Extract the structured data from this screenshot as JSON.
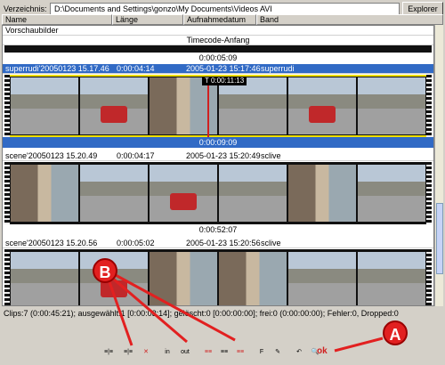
{
  "header": {
    "dir_label": "Verzeichnis:",
    "path": "D:\\Documents and Settings\\gonzo\\My Documents\\Videos AVI",
    "explorer_button": "Explorer"
  },
  "columns": [
    "Name",
    "Länge",
    "Aufnahmedatum",
    "Band"
  ],
  "list": {
    "preview_label": "Vorschaubilder",
    "timecode_label": "Timecode-Anfang",
    "first_duration": "0:00:05:09",
    "clips": [
      {
        "name": "superrudi'20050123 15.17.46",
        "length": "0:00:04:14",
        "date": "2005-01-23 15:17:46",
        "band": "superrudi",
        "duration": "0:00:09:09",
        "timecode": "T 0:00:11:13"
      },
      {
        "name": "scene'20050123 15.20.49",
        "length": "0:00:04:17",
        "date": "2005-01-23 15:20:49",
        "band": "sclive",
        "duration": "0:00:52:07"
      },
      {
        "name": "scene'20050123 15.20.56",
        "length": "0:00:05:02",
        "date": "2005-01-23 15:20:56",
        "band": "sclive",
        "duration": ""
      }
    ]
  },
  "status": "Clips:7 (0:00:45:21); ausgewählt:1 [0:00:03:14]; gelöscht:0 [0:00:00:00]; frei:0 (0:00:00:00); Fehler:0, Dropped:0",
  "toolbar": {
    "buttons": [
      "≡|≡",
      "≡|≡",
      "✕",
      "in",
      "out",
      "≡≡",
      "≡≡",
      "≡≡",
      "F",
      "✎",
      "↶",
      "🔍"
    ],
    "ok": "ok"
  },
  "annotations": {
    "a": "A",
    "b": "B"
  },
  "colors": {
    "selection": "#316ac5",
    "highlight": "#f0e000",
    "annotation": "#e22020"
  }
}
